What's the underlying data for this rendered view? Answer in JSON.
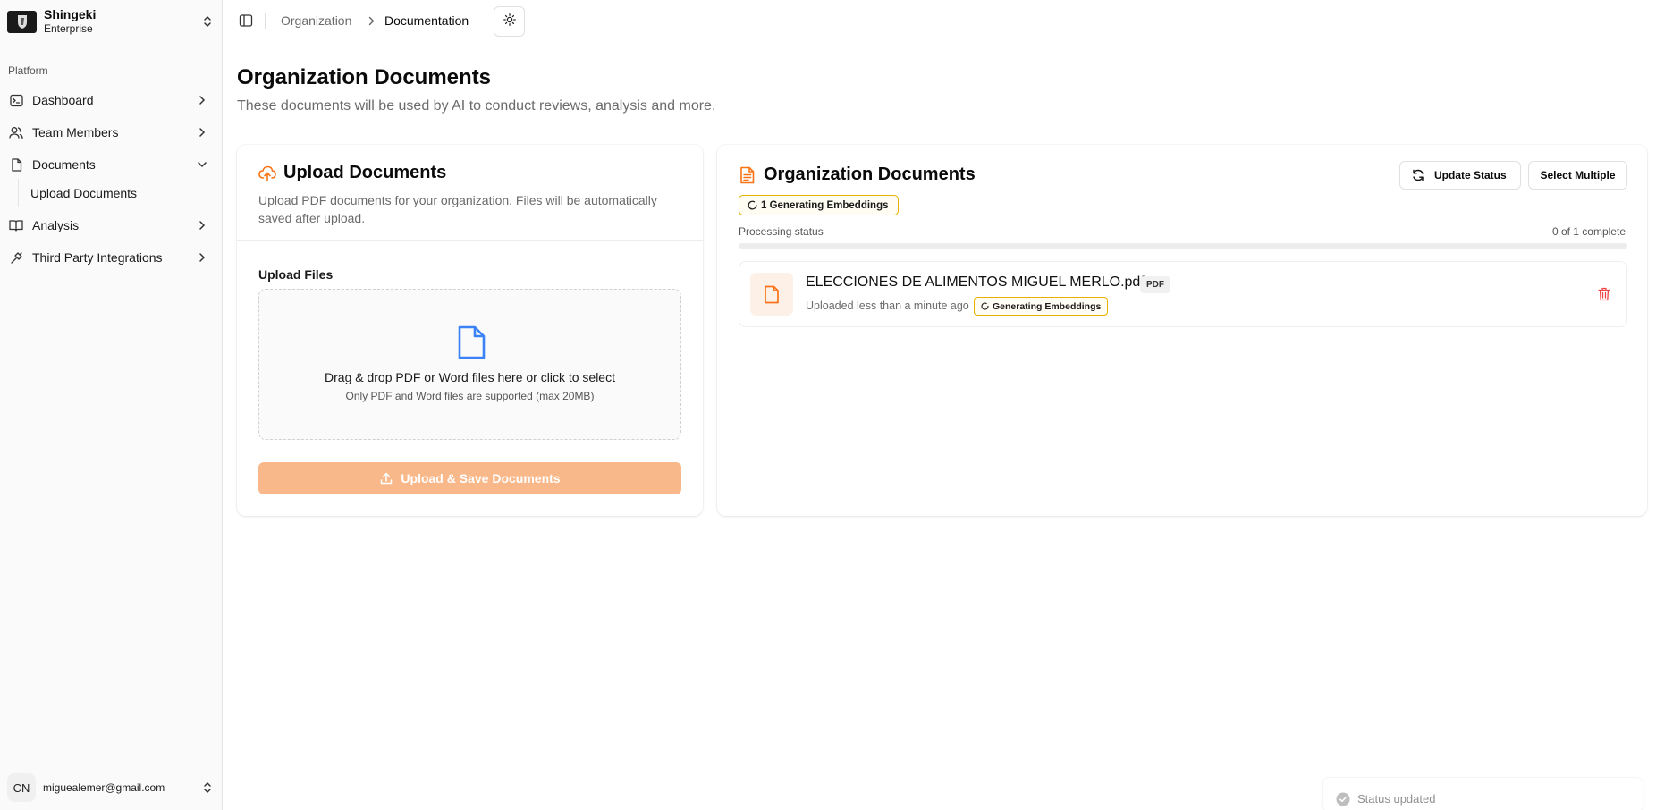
{
  "org": {
    "name": "Shingeki",
    "plan": "Enterprise"
  },
  "sidebar": {
    "group_label": "Platform",
    "items": [
      {
        "label": "Dashboard",
        "icon": "terminal-icon"
      },
      {
        "label": "Team Members",
        "icon": "users-icon"
      },
      {
        "label": "Documents",
        "icon": "file-icon",
        "expanded": true
      },
      {
        "label": "Analysis",
        "icon": "book-open-icon"
      },
      {
        "label": "Third Party Integrations",
        "icon": "plug-icon"
      }
    ],
    "sub_items": [
      {
        "label": "Upload Documents"
      }
    ]
  },
  "user": {
    "initials": "CN",
    "email": "miguealemer@gmail.com"
  },
  "breadcrumb": {
    "items": [
      "Organization",
      "Documentation"
    ]
  },
  "page": {
    "title": "Organization Documents",
    "subtitle": "These documents will be used by AI to conduct reviews, analysis and more."
  },
  "upload_card": {
    "title": "Upload Documents",
    "description": "Upload PDF documents for your organization. Files will be automatically saved after upload.",
    "files_label": "Upload Files",
    "dropzone_main": "Drag & drop PDF or Word files here or click to select",
    "dropzone_sub": "Only PDF and Word files are supported (max 20MB)",
    "button_label": "Upload & Save Documents"
  },
  "docs_card": {
    "title": "Organization Documents",
    "update_status_label": "Update Status",
    "select_multiple_label": "Select Multiple",
    "status_badge": "1 Generating Embeddings",
    "processing_label": "Processing status",
    "processing_count": "0 of 1 complete",
    "progress_fraction": 0,
    "documents": [
      {
        "name": "ELECCIONES DE ALIMENTOS MIGUEL MERLO.pdf",
        "type": "PDF",
        "uploaded": "Uploaded less than a minute ago",
        "status": "Generating Embeddings"
      }
    ]
  },
  "toast": {
    "message": "Status updated"
  },
  "colors": {
    "accent": "#f97316",
    "upload_button_disabled": "#f9b88a",
    "dropzone_icon": "#3b82f6",
    "warning_border": "#e8b100",
    "delete": "#ef4444"
  }
}
